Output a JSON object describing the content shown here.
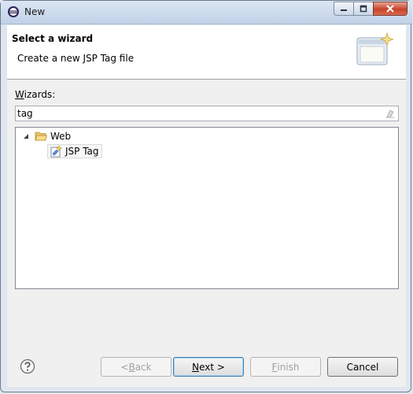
{
  "window": {
    "title": "New",
    "controls": {
      "minimize": "minimize-icon",
      "maximize": "maximize-icon",
      "close": "close-icon"
    }
  },
  "header": {
    "title": "Select a wizard",
    "description": "Create a new JSP Tag file"
  },
  "wizards": {
    "label_mnemonic": "W",
    "label_rest": "izards:",
    "filter_value": "tag",
    "tree": [
      {
        "label": "Web",
        "expanded": true,
        "icon": "folder-open-icon",
        "children": [
          {
            "label": "JSP Tag",
            "icon": "jsp-tag-icon",
            "selected": true
          }
        ]
      }
    ]
  },
  "buttons": {
    "back": {
      "pre": "< ",
      "mnemonic": "B",
      "rest": "ack",
      "enabled": false
    },
    "next": {
      "mnemonic": "N",
      "rest": "ext >",
      "enabled": true,
      "default": true
    },
    "finish": {
      "mnemonic": "F",
      "rest": "inish",
      "enabled": false
    },
    "cancel": {
      "label": "Cancel",
      "enabled": true
    }
  },
  "colors": {
    "titlebar": "#c1d2e7",
    "close_button": "#c7432a",
    "dialog_bg": "#f0f0f0"
  }
}
